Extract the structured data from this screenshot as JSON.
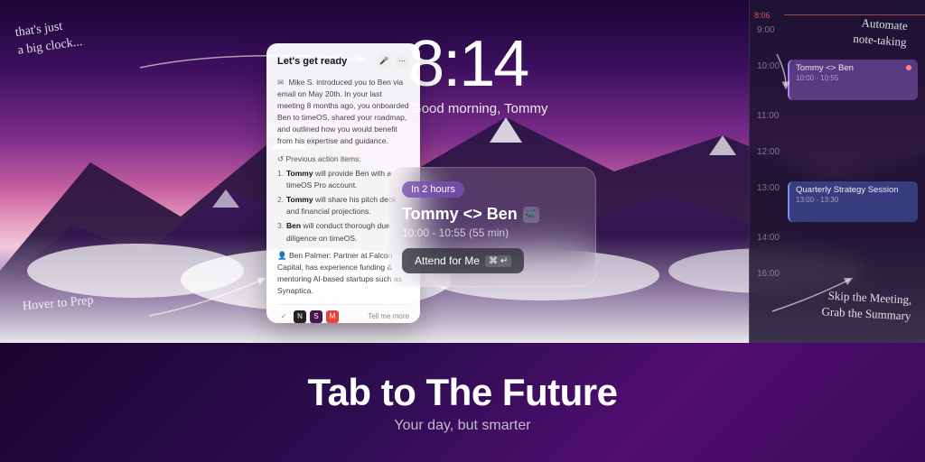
{
  "app": {
    "title": "Tab to The Future",
    "subtitle": "Your day, but smarter"
  },
  "time": {
    "display": "8:14",
    "greeting": "Good morning, Tommy"
  },
  "annotations": {
    "top_left": "that's just\na big clock...",
    "mid_left": "Hover to Prep",
    "top_right": "Automate\nnote-taking",
    "bottom_right": "Skip the Meeting,\nGrab the Summary"
  },
  "meeting_card": {
    "badge": "In 2 hours",
    "title": "Tommy <> Ben",
    "time": "10:00 - 10:55 (55 min)",
    "button": "Attend for Me",
    "kbd": "⌘ ↵"
  },
  "prep_panel": {
    "title": "Let's get ready",
    "intro": "Mike S. introduced you to Ben via email on May 20th. In your last meeting 8 months ago, you onboarded Ben to timeOS, shared your roadmap, and outlined how you would benefit from his expertise and guidance.",
    "actions_header": "Previous action items:",
    "actions": [
      "Tommy will provide Ben with a timeOS Pro account.",
      "Tommy will share his pitch deck and financial projections.",
      "Ben will conduct thorough due diligence on timeOS."
    ],
    "bio": "Ben Palmer: Partner at Falcon Capital, has experience funding & mentoring AI-based startups such as Synaptica.",
    "tell_more": "Tell me more"
  },
  "calendar": {
    "current_time": "8:06",
    "slots": [
      {
        "time": "9:00",
        "event": null
      },
      {
        "time": "10:00",
        "event": {
          "title": "Tommy <> Ben",
          "time": "10:00 - 10:55",
          "color": "purple",
          "dot": true
        }
      },
      {
        "time": "11:00",
        "event": null
      },
      {
        "time": "12:00",
        "event": null
      },
      {
        "time": "13:00",
        "event": {
          "title": "Quarterly Strategy Session",
          "time": "13:00 - 13:30",
          "color": "blue",
          "dot": false
        }
      },
      {
        "time": "14:00",
        "event": null
      },
      {
        "time": "16:00",
        "event": null
      }
    ]
  },
  "icons": {
    "mic": "🎤",
    "sun": "🌤",
    "email": "✉",
    "refresh": "↺",
    "check": "✓",
    "notion": "N",
    "slack": "S",
    "gmail": "M"
  }
}
